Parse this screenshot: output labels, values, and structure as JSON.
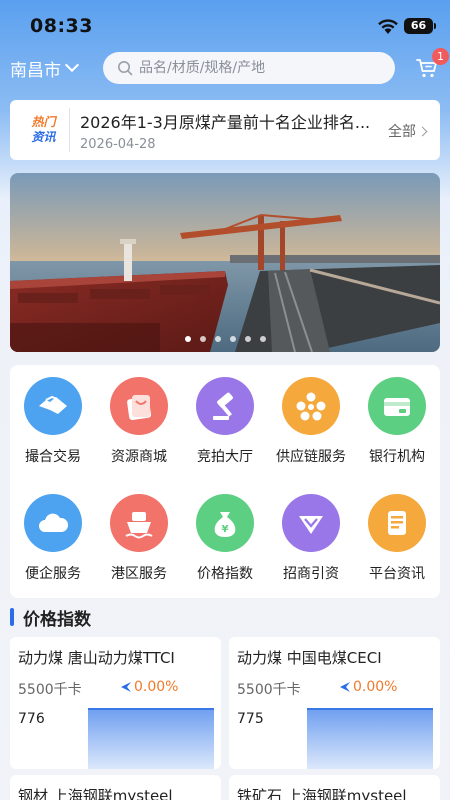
{
  "status": {
    "time": "08:33",
    "battery": "66"
  },
  "header": {
    "city": "南昌市",
    "search_placeholder": "品名/材质/规格/产地",
    "cart_badge": "1"
  },
  "news": {
    "logo_line1": "热门",
    "logo_line2": "资讯",
    "title": "2026年1-3月原煤产量前十名企业排名...",
    "date": "2026-04-28",
    "all_label": "全部"
  },
  "banner": {
    "slides": 6,
    "active_index": 0
  },
  "grid": {
    "items": [
      {
        "label": "撮合交易",
        "icon": "handshake-icon",
        "color": "#4ea3f1"
      },
      {
        "label": "资源商城",
        "icon": "shopping-bag-icon",
        "color": "#f2736a"
      },
      {
        "label": "竞拍大厅",
        "icon": "gavel-icon",
        "color": "#9a77e8"
      },
      {
        "label": "供应链服务",
        "icon": "network-icon",
        "color": "#f5a83c"
      },
      {
        "label": "银行机构",
        "icon": "bank-card-icon",
        "color": "#5dcf82"
      },
      {
        "label": "便企服务",
        "icon": "cloud-icon",
        "color": "#4ea3f1"
      },
      {
        "label": "港区服务",
        "icon": "ship-icon",
        "color": "#f2736a"
      },
      {
        "label": "价格指数",
        "icon": "money-bag-icon",
        "color": "#5dcf82"
      },
      {
        "label": "招商引资",
        "icon": "diamond-icon",
        "color": "#9a77e8"
      },
      {
        "label": "平台资讯",
        "icon": "document-icon",
        "color": "#f5a83c"
      }
    ]
  },
  "price_section": {
    "title": "价格指数",
    "cards": [
      {
        "name": "动力煤 唐山动力煤TTCI",
        "spec": "5500千卡",
        "change": "0.00%",
        "price": "776"
      },
      {
        "name": "动力煤 中国电煤CECI",
        "spec": "5500千卡",
        "change": "0.00%",
        "price": "775"
      },
      {
        "name": "钢材 上海钢联mysteel",
        "spec": "",
        "change": "",
        "price": ""
      },
      {
        "name": "铁矿石 上海钢联mysteel",
        "spec": "",
        "change": "",
        "price": ""
      }
    ]
  }
}
